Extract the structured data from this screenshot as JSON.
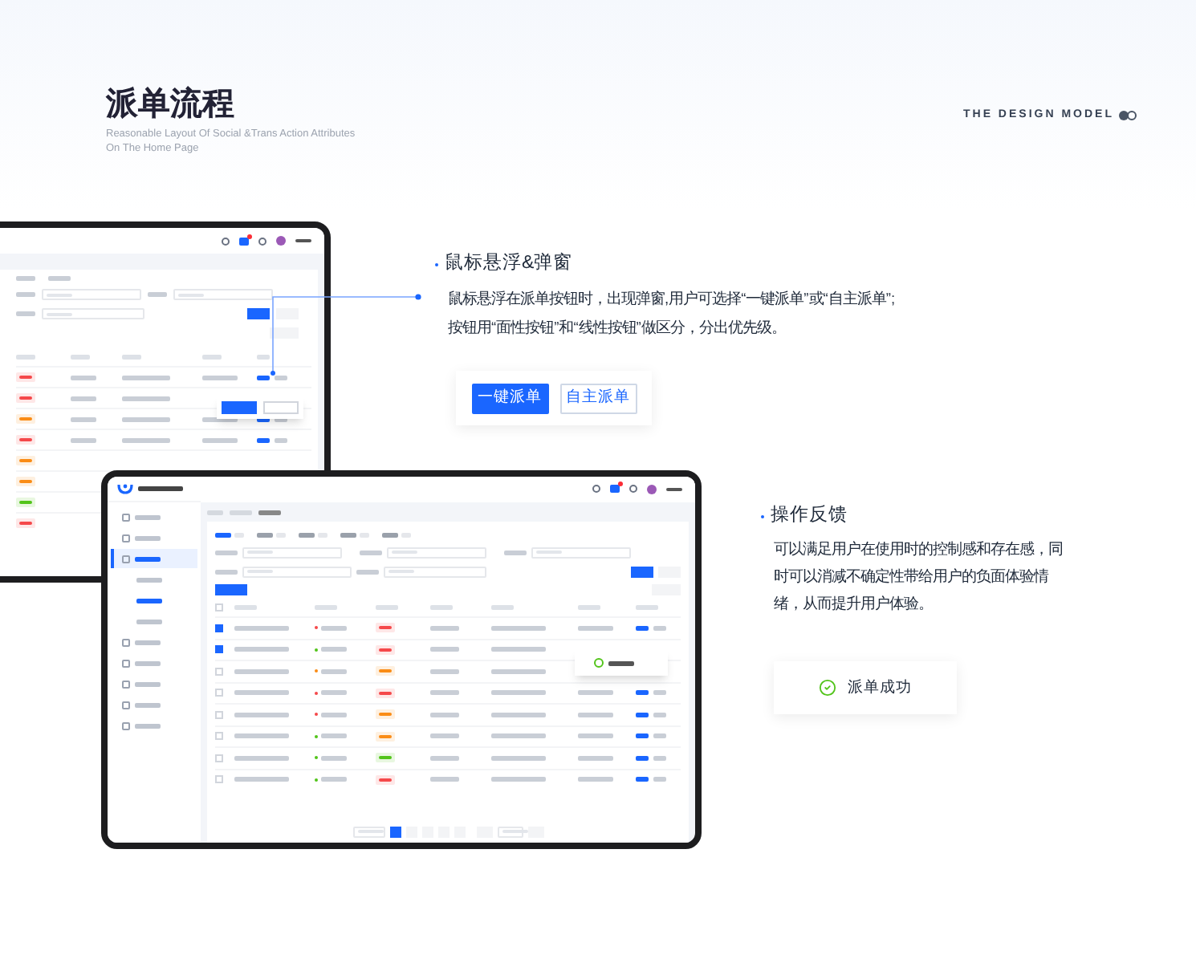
{
  "header": {
    "title": "派单流程",
    "subtitle": [
      "Reasonable Layout Of Social &Trans Action Attributes",
      "On The Home Page"
    ],
    "brand": "THE DESIGN MODEL"
  },
  "section_hover": {
    "title": "鼠标悬浮&弹窗",
    "text": [
      "鼠标悬浮在派单按钮时，出现弹窗,用户可选择“一键派单”或“自主派单”;",
      "按钮用“面性按钮”和“线性按钮”做区分，分出优先级。"
    ],
    "buttons": [
      {
        "label": "一键派单",
        "kind": "filled"
      },
      {
        "label": "自主派单",
        "kind": "outline"
      }
    ]
  },
  "section_feedback": {
    "title": "操作反馈",
    "text": [
      "可以满足用户在使用时的控制感和存在感，同",
      "时可以消减不确定性带给用户的负面体验情",
      "绪，从而提升用户体验。"
    ],
    "toast": "派单成功"
  }
}
